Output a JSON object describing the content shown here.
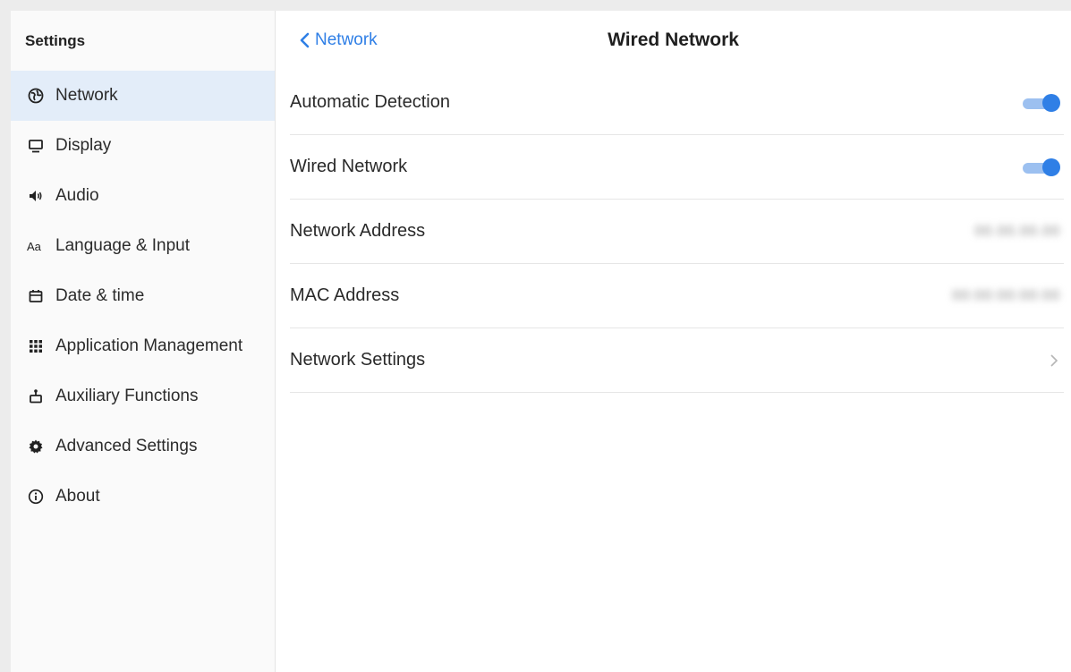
{
  "sidebar": {
    "title": "Settings",
    "items": [
      {
        "label": "Network",
        "icon": "globe-icon",
        "active": true
      },
      {
        "label": "Display",
        "icon": "monitor-icon"
      },
      {
        "label": "Audio",
        "icon": "speaker-icon"
      },
      {
        "label": "Language & Input",
        "icon": "text-aa-icon"
      },
      {
        "label": "Date & time",
        "icon": "calendar-icon"
      },
      {
        "label": "Application Management",
        "icon": "grid-icon"
      },
      {
        "label": "Auxiliary Functions",
        "icon": "accessibility-icon"
      },
      {
        "label": "Advanced Settings",
        "icon": "gear-icon"
      },
      {
        "label": "About",
        "icon": "info-icon"
      }
    ]
  },
  "header": {
    "back_label": "Network",
    "title": "Wired Network"
  },
  "rows": {
    "automatic_detection": {
      "label": "Automatic Detection",
      "enabled": true
    },
    "wired_network": {
      "label": "Wired Network",
      "enabled": true
    },
    "network_address": {
      "label": "Network Address",
      "value": "00.00.00.00"
    },
    "mac_address": {
      "label": "MAC Address",
      "value": "00:00:00:00:00"
    },
    "network_settings": {
      "label": "Network Settings"
    }
  },
  "colors": {
    "accent": "#2f7fe6",
    "active_bg": "#e3edf9"
  }
}
